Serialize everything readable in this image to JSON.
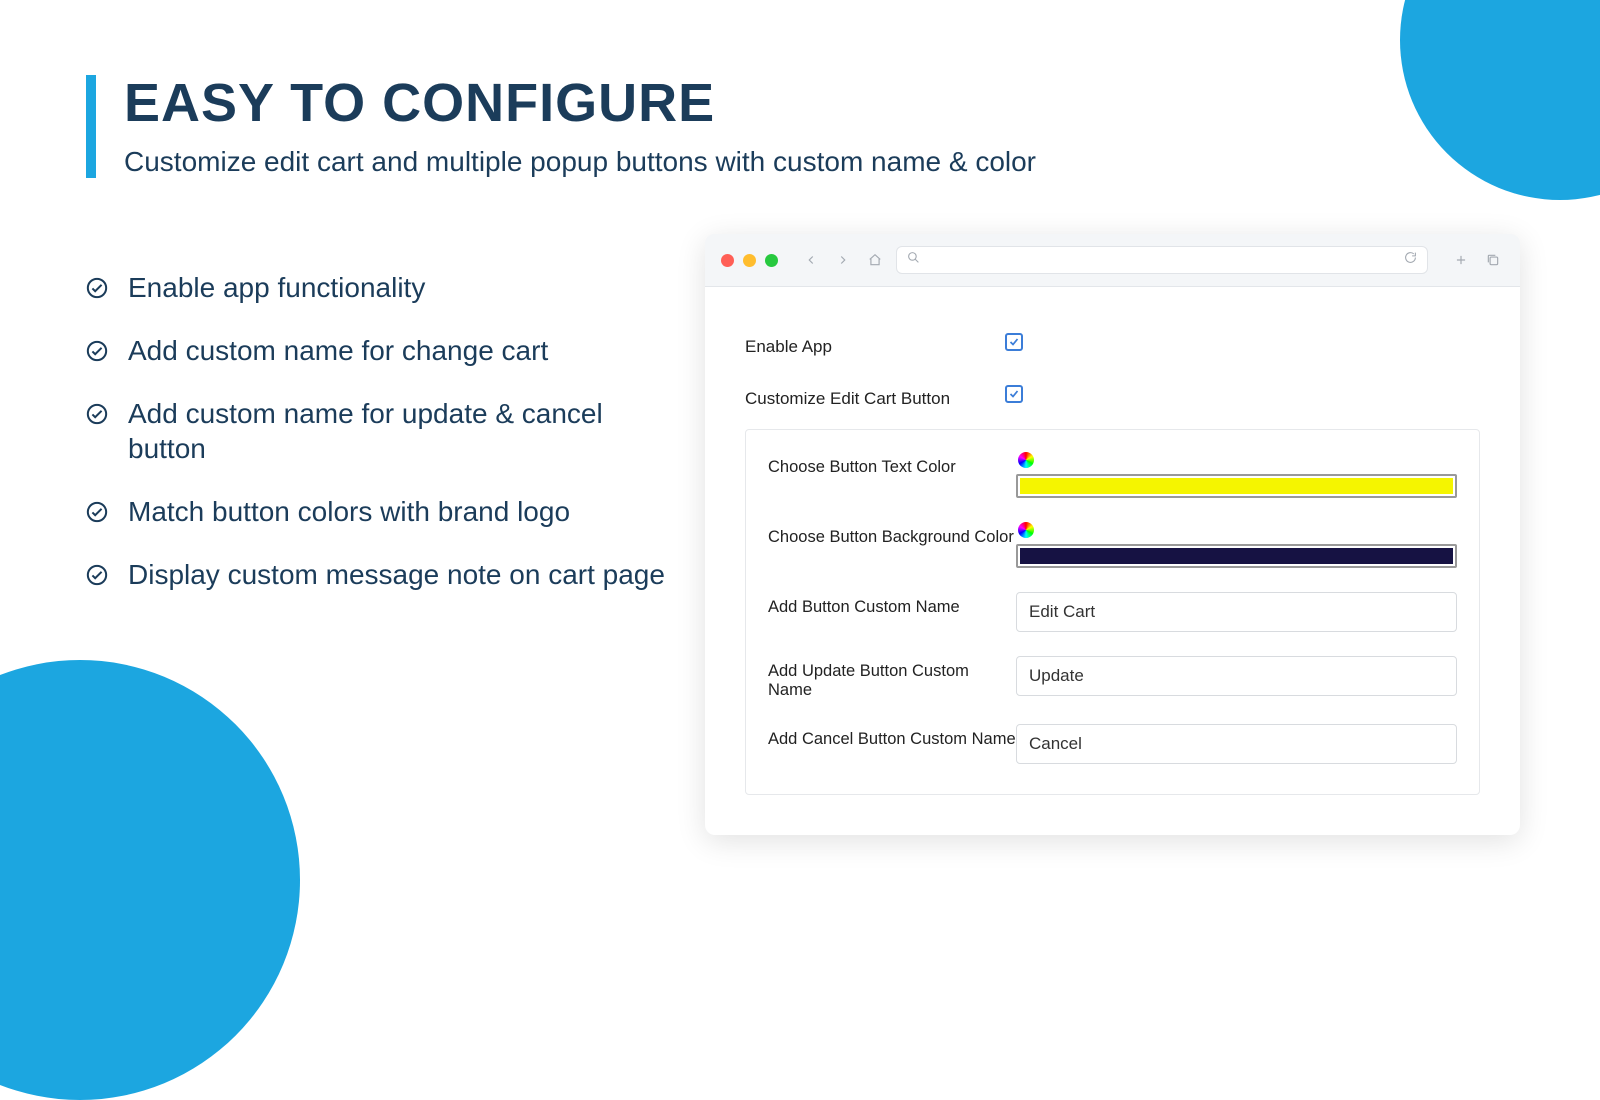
{
  "header": {
    "title": "EASY TO CONFIGURE",
    "subtitle": "Customize edit cart and multiple popup buttons with custom name & color"
  },
  "features": [
    "Enable app functionality",
    "Add custom name for change cart",
    "Add custom name for update & cancel button",
    "Match button colors with brand logo",
    "Display custom message note on cart page"
  ],
  "form": {
    "enable_app_label": "Enable App",
    "enable_app_checked": true,
    "customize_label": "Customize Edit Cart Button",
    "customize_checked": true,
    "text_color_label": "Choose Button Text Color",
    "text_color_value": "#f5f500",
    "bg_color_label": "Choose Button Background Color",
    "bg_color_value": "#161243",
    "button_name_label": "Add Button Custom Name",
    "button_name_value": "Edit Cart",
    "update_name_label": "Add Update Button Custom Name",
    "update_name_value": "Update",
    "cancel_name_label": "Add Cancel Button Custom Name",
    "cancel_name_value": "Cancel"
  },
  "colors": {
    "accent": "#1ca6e0",
    "heading": "#1b3c5a"
  }
}
